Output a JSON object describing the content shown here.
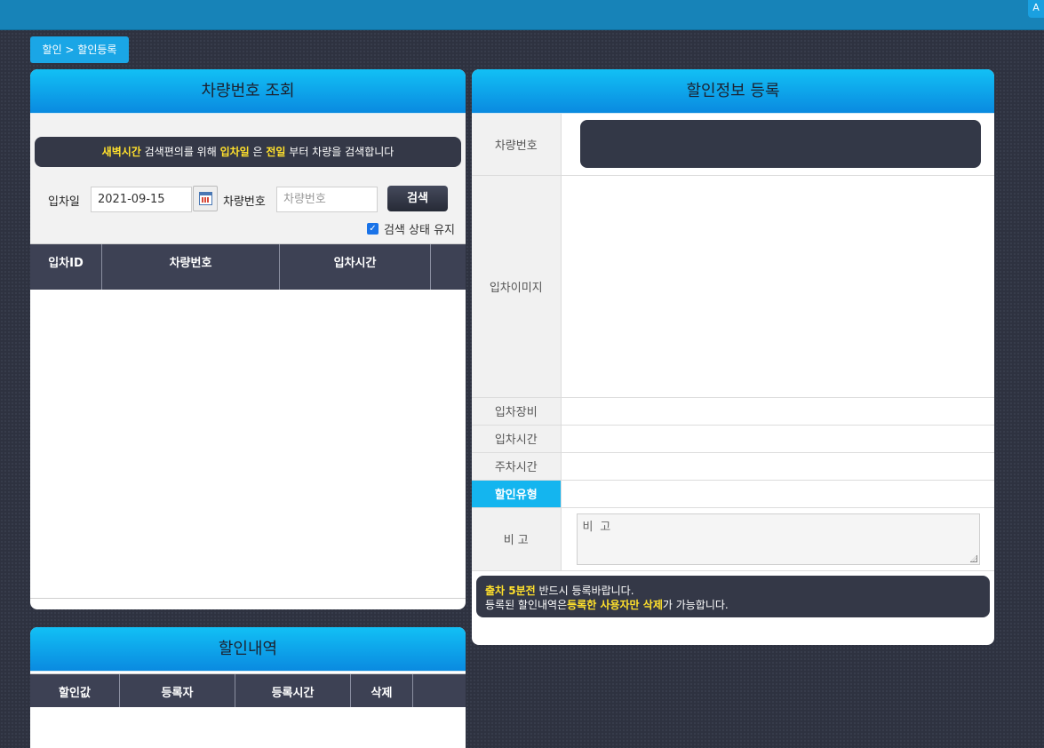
{
  "topbar": {
    "corner_label": "A"
  },
  "breadcrumb": "할인 > 할인등록",
  "search_panel": {
    "title": "차량번호 조회",
    "notice": {
      "part1": "새벽시간",
      "part2": " 검색편의를 위해 ",
      "part3": "입차일",
      "part4": " 은 ",
      "part5": "전일",
      "part6": " 부터 차량을 검색합니다"
    },
    "date_label": "입차일",
    "date_value": "2021-09-15",
    "plate_label": "차량번호",
    "plate_placeholder": "차량번호",
    "search_button": "검색",
    "keep_state_label": "검색 상태 유지",
    "keep_state_checked": true,
    "columns": [
      "입차ID",
      "차량번호",
      "입차시간"
    ]
  },
  "register_panel": {
    "title": "할인정보 등록",
    "rows": {
      "plate": "차량번호",
      "image": "입차이미지",
      "device": "입차장비",
      "entry_time": "입차시간",
      "parking_time": "주차시간",
      "discount_type": "할인유형",
      "remark": "비 고"
    },
    "remark_placeholder": "비 고",
    "notice": {
      "line1_hl": "출차 5분전",
      "line1_rest": " 반드시 등록바랍니다.",
      "line2_a": "등록된 할인내역은",
      "line2_hl": "등록한 사용자만 삭제",
      "line2_b": "가 가능합니다."
    }
  },
  "history_panel": {
    "title": "할인내역",
    "columns": [
      "할인값",
      "등록자",
      "등록시간",
      "삭제"
    ]
  }
}
